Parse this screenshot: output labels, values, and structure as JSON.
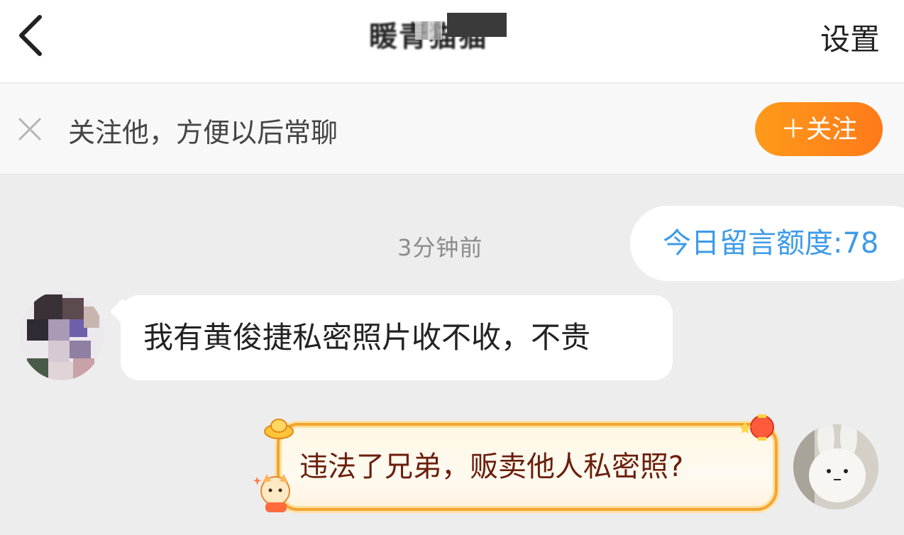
{
  "header": {
    "title": "䁔青猫猫",
    "settings_label": "设置",
    "back_icon": "chevron-left-icon"
  },
  "follow_bar": {
    "text": "关注他，方便以后常聊",
    "button_label": "＋关注",
    "close_icon": "close-icon"
  },
  "chat": {
    "timestamp": "3分钟前",
    "quota": "今日留言额度:78",
    "messages": [
      {
        "side": "left",
        "text": "我有黄俊捷私密照片收不收，不贵"
      },
      {
        "side": "right",
        "text": "违法了兄弟，贩卖他人私密照?"
      }
    ]
  },
  "colors": {
    "accent_orange": "#ff8a1a",
    "quota_blue": "#3d9be9",
    "bubble_border": "#f3a431",
    "background": "#ededed"
  }
}
